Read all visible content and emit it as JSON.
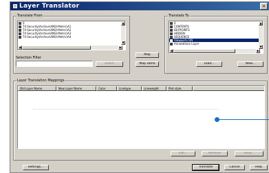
{
  "window": {
    "title": "Layer Translator",
    "close_glyph": "×"
  },
  "translate_from": {
    "label": "Translate From",
    "items": [
      "0",
      "T4 Security\\Archive\\ANSI-Metric\\A1",
      "T4 Security\\Archive\\ANSI-Metric\\A2",
      "T4 Security\\Archive\\ANSI-Metric\\A3",
      "T4 Security\\Archive\\ANSI-Metric\\A4"
    ]
  },
  "selection_filter": {
    "label": "Selection Filter",
    "input_value": "",
    "select_button": "Select"
  },
  "middle": {
    "map_button": "Map",
    "map_same_button": "Map same"
  },
  "translate_to": {
    "label": "Translate To",
    "items": [
      "0",
      "CONTENTS",
      "DEFPOINTS",
      "HIDDEN",
      "SEQUENCE",
      "Viewports ON",
      "Annotations Layer"
    ],
    "selected_index": 5,
    "load_button": "Load...",
    "new_button": "New..."
  },
  "mappings": {
    "label": "Layer Translation Mappings",
    "columns": [
      "Old Layer Name",
      "New Layer Name",
      "Color",
      "Linetype",
      "Lineweight",
      "Plot style"
    ],
    "edit_button": "Edit...",
    "remove_button": "Remove",
    "save_button": "Save..."
  },
  "footer": {
    "settings_button": "Settings...",
    "translate_button": "Translate",
    "cancel_button": "Cancel",
    "help_button": "Help"
  },
  "colors": {
    "title_bar": "#0a246a",
    "selection": "#0a246a",
    "dialog_bg": "#d4d0c8",
    "callout": "#1a6fc4"
  }
}
